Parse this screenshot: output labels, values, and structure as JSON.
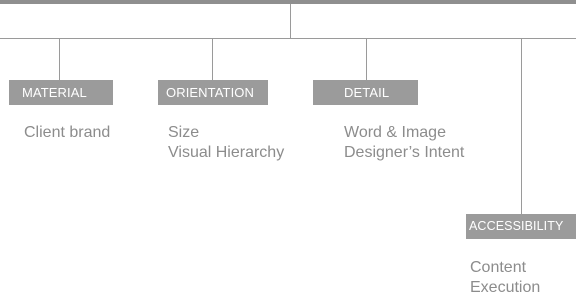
{
  "nodes": [
    {
      "label": "MATERIAL",
      "lines": [
        "Client brand"
      ]
    },
    {
      "label": "ORIENTATION",
      "lines": [
        "Size",
        "Visual Hierarchy"
      ]
    },
    {
      "label": "DETAIL",
      "lines": [
        "Word & Image",
        "Designer’s Intent"
      ]
    },
    {
      "label": "ACCESSIBILITY",
      "lines": [
        "Content",
        "Execution"
      ]
    }
  ]
}
